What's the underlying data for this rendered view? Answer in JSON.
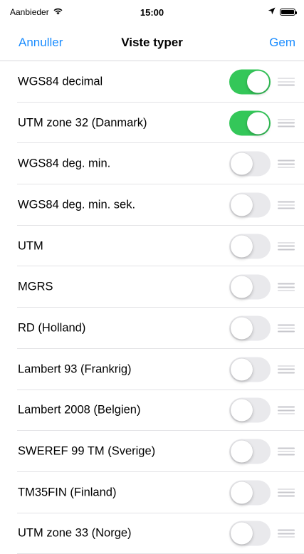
{
  "status_bar": {
    "carrier": "Aanbieder",
    "time": "15:00",
    "wifi_icon": "wifi-icon",
    "location_icon": "location-arrow-icon",
    "battery_icon": "battery-icon"
  },
  "nav": {
    "cancel_label": "Annuller",
    "title": "Viste typer",
    "save_label": "Gem"
  },
  "colors": {
    "accent": "#1a8cff",
    "toggle_on": "#34c759",
    "toggle_off": "#e9e9ec"
  },
  "items": [
    {
      "label": "WGS84 decimal",
      "enabled": true
    },
    {
      "label": "UTM zone 32 (Danmark)",
      "enabled": true
    },
    {
      "label": "WGS84 deg. min.",
      "enabled": false
    },
    {
      "label": "WGS84 deg. min. sek.",
      "enabled": false
    },
    {
      "label": "UTM",
      "enabled": false
    },
    {
      "label": "MGRS",
      "enabled": false
    },
    {
      "label": "RD (Holland)",
      "enabled": false
    },
    {
      "label": "Lambert 93 (Frankrig)",
      "enabled": false
    },
    {
      "label": "Lambert 2008 (Belgien)",
      "enabled": false
    },
    {
      "label": "SWEREF 99 TM (Sverige)",
      "enabled": false
    },
    {
      "label": "TM35FIN (Finland)",
      "enabled": false
    },
    {
      "label": "UTM zone 33 (Norge)",
      "enabled": false
    }
  ]
}
